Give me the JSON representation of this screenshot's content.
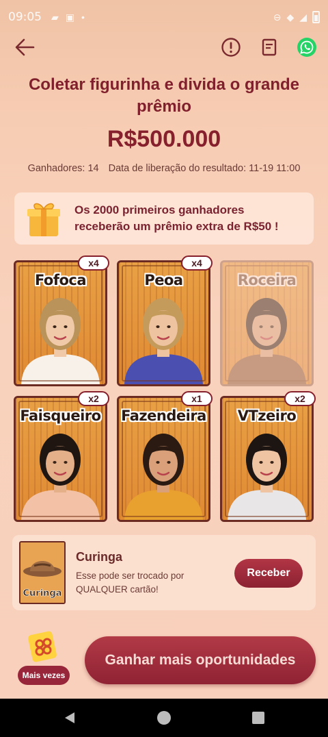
{
  "status_bar": {
    "time": "09:05"
  },
  "header": {
    "title": "Coletar figurinha e divida o grande prêmio",
    "amount": "R$500.000",
    "winners": "Ganhadores: 14",
    "release": "Data de liberação do resultado: 11-19 11:00"
  },
  "promo": {
    "line1": "Os 2000 primeiros ganhadores",
    "line2": "receberão um prêmio extra de R$50 !"
  },
  "cards": [
    {
      "name": "Fofoca",
      "count": "x4",
      "collected": true
    },
    {
      "name": "Peoa",
      "count": "x4",
      "collected": true
    },
    {
      "name": "Roceira",
      "count": "",
      "collected": false
    },
    {
      "name": "Faisqueiro",
      "count": "x2",
      "collected": true
    },
    {
      "name": "Fazendeira",
      "count": "x1",
      "collected": true
    },
    {
      "name": "VTzeiro",
      "count": "x2",
      "collected": true
    }
  ],
  "joker": {
    "card_label": "Curinga",
    "title": "Curinga",
    "description": "Esse pode ser trocado por QUALQUER cartão!",
    "button": "Receber"
  },
  "bottom": {
    "more_times": "Mais vezes",
    "cta": "Ganhar mais oportunidades"
  },
  "colors": {
    "accent": "#8c2231",
    "title": "#80202c",
    "card_orange": "#e59a3f",
    "whatsapp": "#25d366"
  }
}
